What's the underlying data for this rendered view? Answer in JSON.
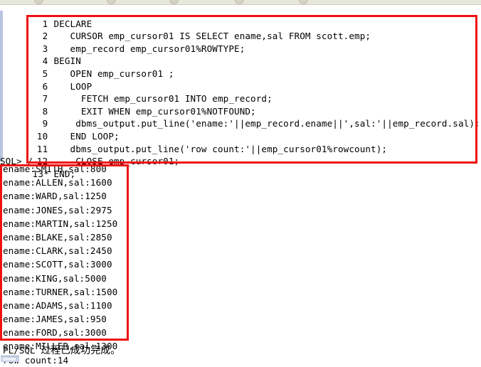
{
  "toolbar": {
    "icons": [
      "toolbar-icon-1",
      "toolbar-icon-2",
      "toolbar-icon-3",
      "toolbar-icon-4",
      "toolbar-icon-5"
    ]
  },
  "colors": {
    "annotation_red": "#ee1111",
    "background": "#ffffff",
    "text": "#000000",
    "toolbar_bg": "#e8e7dc",
    "gutter_rail": "#b9c3e0"
  },
  "code_buffer": {
    "lines": [
      {
        "num": "1",
        "text": "DECLARE"
      },
      {
        "num": "2",
        "text": "   CURSOR emp_cursor01 IS SELECT ename,sal FROM scott.emp;"
      },
      {
        "num": "3",
        "text": "   emp_record emp_cursor01%ROWTYPE;"
      },
      {
        "num": "4",
        "text": "BEGIN"
      },
      {
        "num": "5",
        "text": "   OPEN emp_cursor01 ;"
      },
      {
        "num": "6",
        "text": "   LOOP"
      },
      {
        "num": "7",
        "text": "     FETCH emp_cursor01 INTO emp_record;"
      },
      {
        "num": "8",
        "text": "     EXIT WHEN emp_cursor01%NOTFOUND;"
      },
      {
        "num": "9",
        "text": "    dbms_output.put_line('ename:'||emp_record.ename||',sal:'||emp_record.sal);"
      },
      {
        "num": "10",
        "text": "   END LOOP;"
      },
      {
        "num": "11",
        "text": "   dbms_output.put_line('row count:'||emp_cursor01%rowcount);"
      },
      {
        "num": "12",
        "text": "    CLOSE emp_cursor01;"
      },
      {
        "num": "13*",
        "text": "END;"
      }
    ]
  },
  "prompt": {
    "text": "SQL> /"
  },
  "output": {
    "lines": [
      "ename:SMITH,sal:800",
      "ename:ALLEN,sal:1600",
      "ename:WARD,sal:1250",
      "ename:JONES,sal:2975",
      "ename:MARTIN,sal:1250",
      "ename:BLAKE,sal:2850",
      "ename:CLARK,sal:2450",
      "ename:SCOTT,sal:3000",
      "ename:KING,sal:5000",
      "ename:TURNER,sal:1500",
      "ename:ADAMS,sal:1100",
      "ename:JAMES,sal:950",
      "ename:FORD,sal:3000",
      "ename:MILLER,sal:1300",
      "row count:14"
    ]
  },
  "status": {
    "prefix": "PL/SQL ",
    "message": "过程已成功完成。"
  },
  "annotations": [
    {
      "name": "code-highlight-box",
      "color": "#ee1111"
    },
    {
      "name": "output-highlight-box",
      "color": "#ee1111"
    }
  ]
}
